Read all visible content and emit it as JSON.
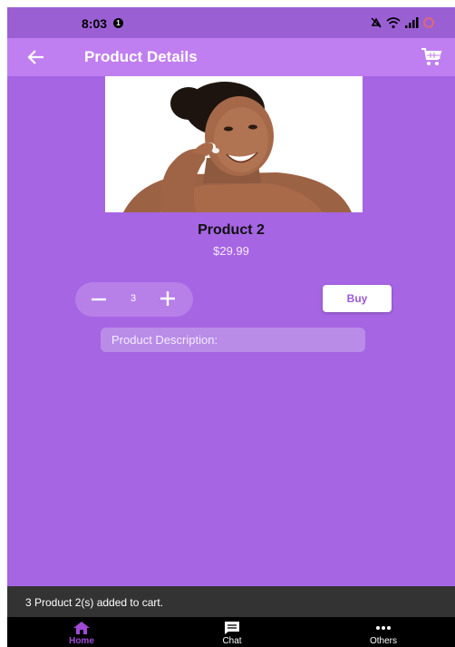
{
  "status_bar": {
    "time": "8:03",
    "notification_badge": "1",
    "icons": [
      "mute-icon",
      "wifi-icon",
      "signal-icon",
      "battery-icon"
    ]
  },
  "app_bar": {
    "title": "Product Details",
    "back_icon": "arrow-left-icon",
    "cart_icon": "cart-icon"
  },
  "product": {
    "image": "woman-applying-face-cream-photo",
    "name": "Product 2",
    "price": "$29.99",
    "quantity": "3",
    "buy_label": "Buy",
    "description_label": "Product Description:"
  },
  "snackbar": {
    "message": "3 Product 2(s) added to cart."
  },
  "bottom_nav": {
    "items": [
      {
        "label": "Home",
        "icon": "home-icon",
        "selected": true
      },
      {
        "label": "Chat",
        "icon": "chat-icon",
        "selected": false
      },
      {
        "label": "Others",
        "icon": "more-icon",
        "selected": false
      }
    ]
  },
  "colors": {
    "background": "#a665e3",
    "app_bar": "#c07ff0",
    "accent": "#a04ad6",
    "snackbar": "#333333",
    "bottom_nav": "#000000"
  }
}
